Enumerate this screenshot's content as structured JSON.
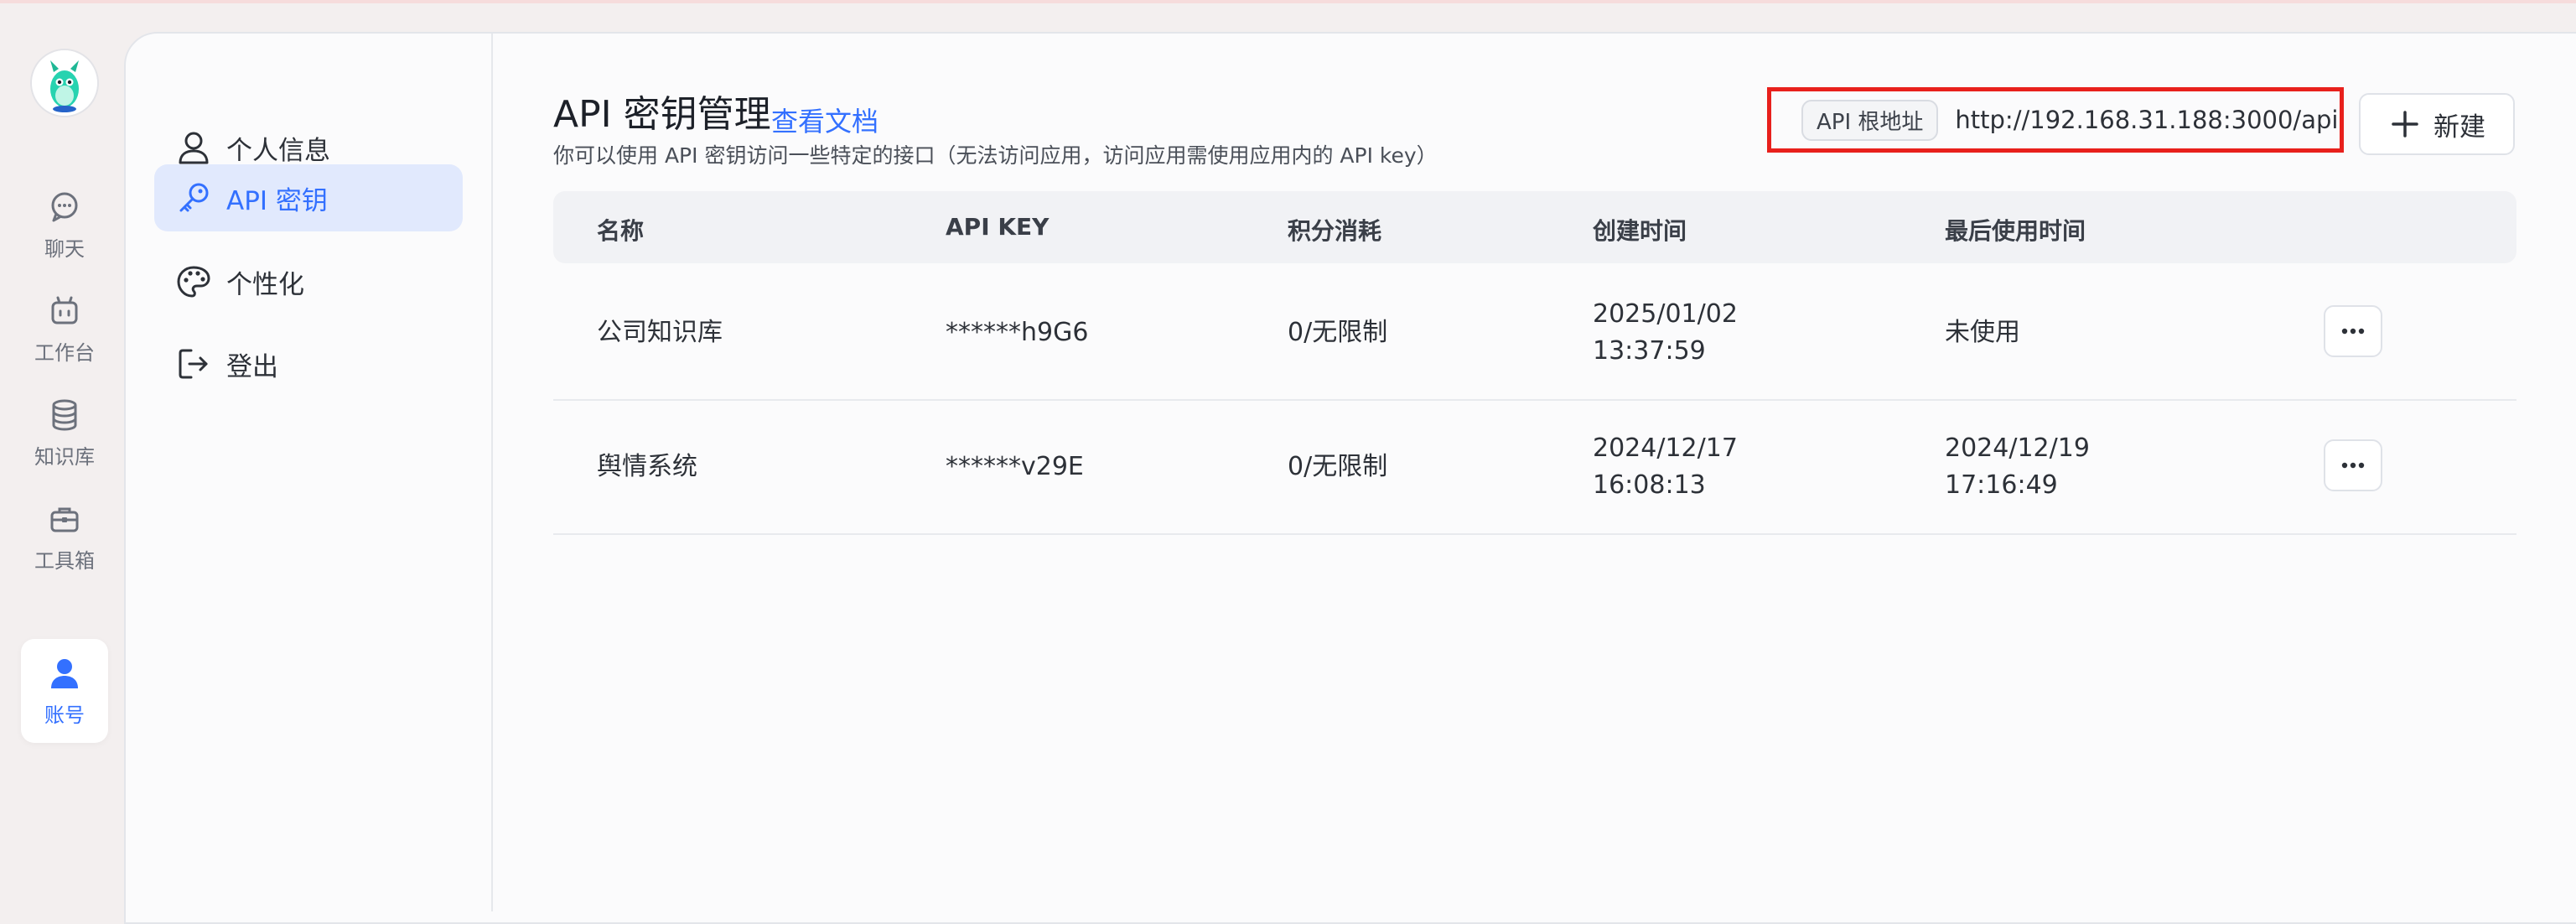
{
  "rail": {
    "items": [
      {
        "label": "聊天",
        "icon": "chat-icon"
      },
      {
        "label": "工作台",
        "icon": "robot-icon"
      },
      {
        "label": "知识库",
        "icon": "database-icon"
      },
      {
        "label": "工具箱",
        "icon": "toolbox-icon"
      },
      {
        "label": "账号",
        "icon": "user-icon",
        "active": true
      }
    ]
  },
  "subnav": {
    "items": [
      {
        "label": "个人信息",
        "icon": "user-outline-icon"
      },
      {
        "label": "API 密钥",
        "icon": "key-icon",
        "active": true
      },
      {
        "label": "个性化",
        "icon": "palette-icon"
      },
      {
        "label": "登出",
        "icon": "logout-icon"
      }
    ]
  },
  "header": {
    "title": "API 密钥管理",
    "doc_link": "查看文档",
    "subtitle": "你可以使用 API 密钥访问一些特定的接口（无法访问应用，访问应用需使用应用内的 API key）",
    "root_label": "API 根地址",
    "root_url": "http://192.168.31.188:3000/api",
    "new_button": "新建"
  },
  "table": {
    "columns": [
      "名称",
      "API KEY",
      "积分消耗",
      "创建时间",
      "最后使用时间"
    ],
    "rows": [
      {
        "name": "公司知识库",
        "key": "******h9G6",
        "points": "0/无限制",
        "created_date": "2025/01/02",
        "created_time": "13:37:59",
        "last_used": "未使用",
        "last_used_time": ""
      },
      {
        "name": "舆情系统",
        "key": "******v29E",
        "points": "0/无限制",
        "created_date": "2024/12/17",
        "created_time": "16:08:13",
        "last_used": "2024/12/19",
        "last_used_time": "17:16:49"
      }
    ]
  },
  "colors": {
    "accent": "#3370ff",
    "highlight_border": "#e8201c",
    "active_nav_bg": "#e1e9fd"
  }
}
